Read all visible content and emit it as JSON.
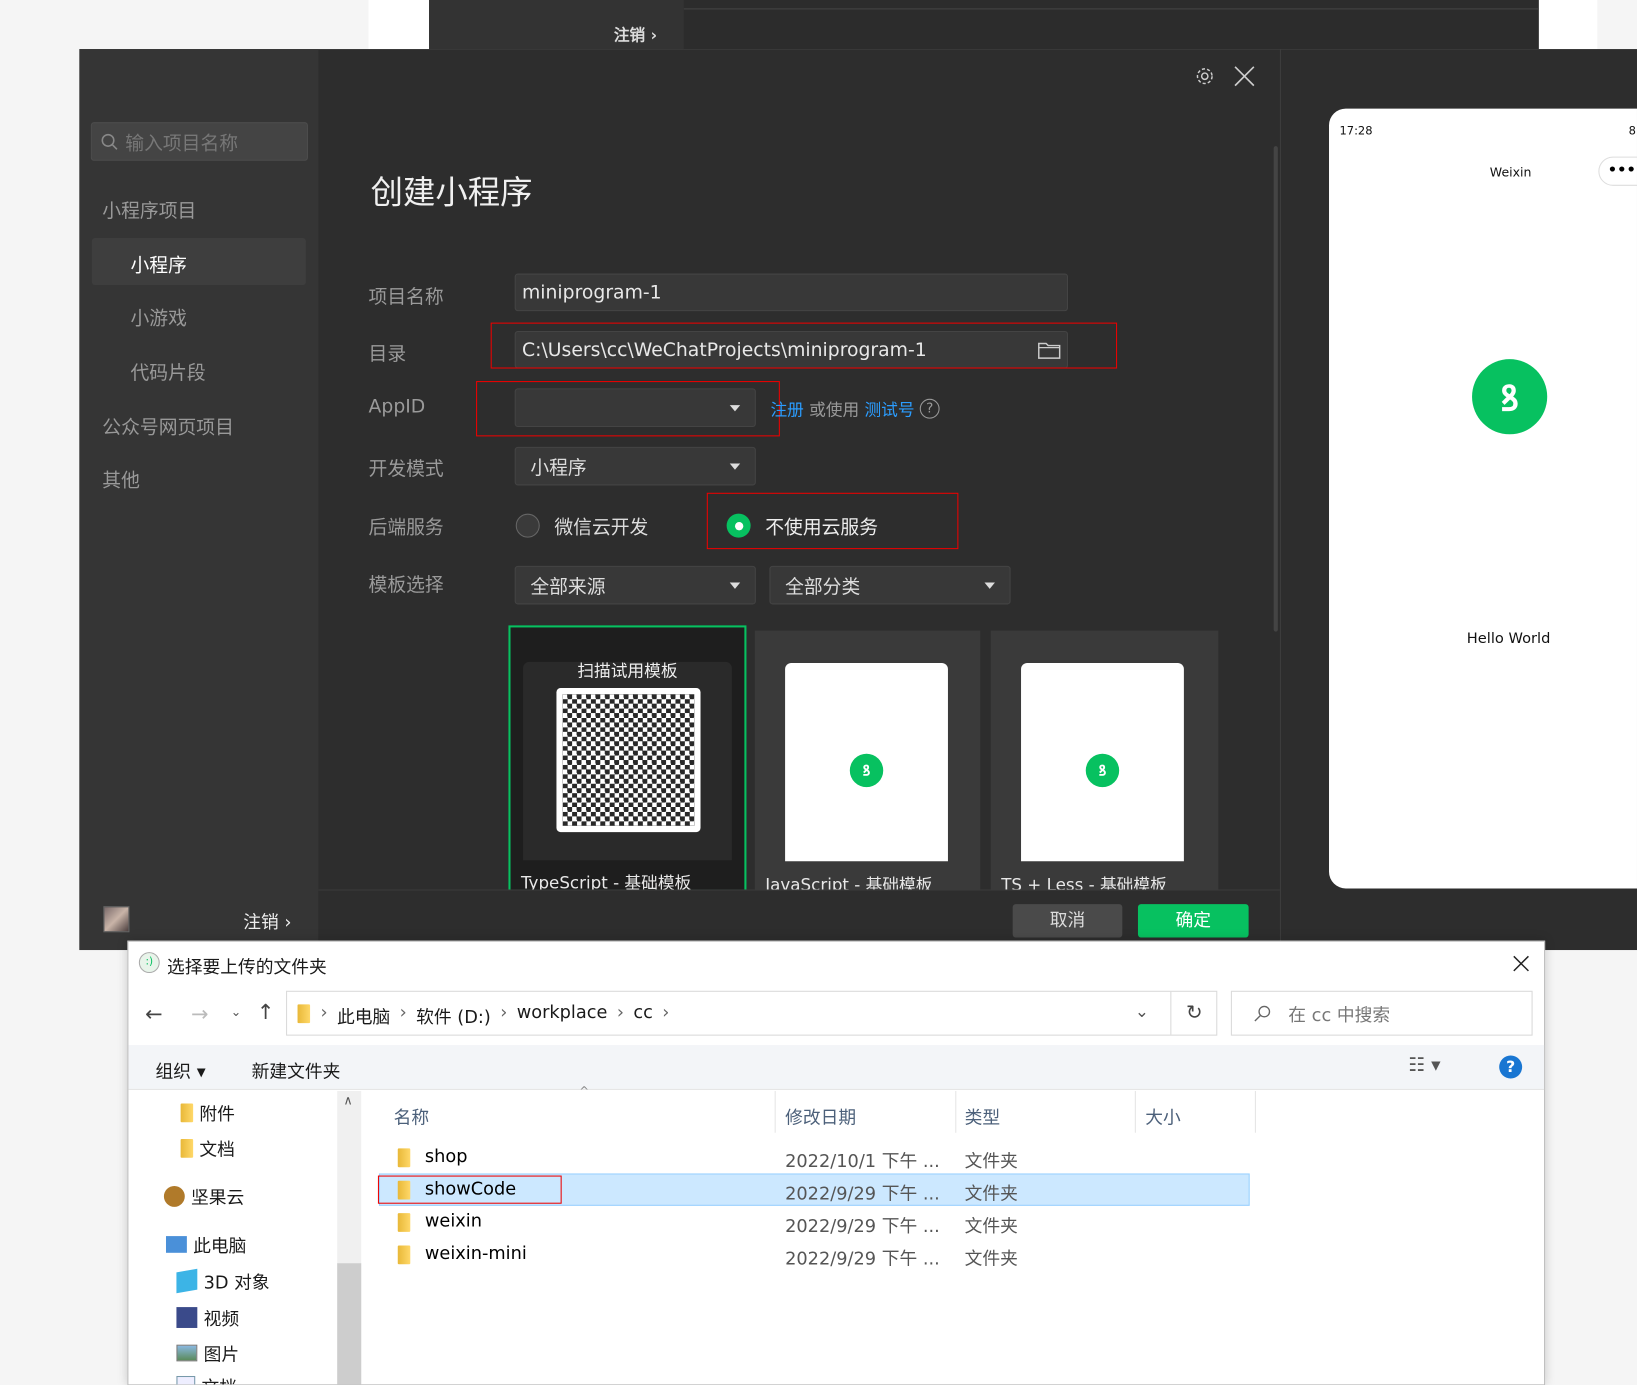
{
  "bg_window": {
    "logout": "注销 ›"
  },
  "sidebar": {
    "search_placeholder": "输入项目名称",
    "items": [
      {
        "label": "小程序项目"
      },
      {
        "label": "小程序"
      },
      {
        "label": "小游戏"
      },
      {
        "label": "代码片段"
      },
      {
        "label": "公众号网页项目"
      },
      {
        "label": "其他"
      }
    ],
    "logout": "注销 ›"
  },
  "dialog": {
    "title": "创建小程序",
    "fields": {
      "name_label": "项目名称",
      "name_value": "miniprogram-1",
      "dir_label": "目录",
      "dir_value": "C:\\Users\\cc\\WeChatProjects\\miniprogram-1",
      "appid_label": "AppID",
      "appid_register": "注册",
      "appid_or": "或使用",
      "appid_test": "测试号",
      "mode_label": "开发模式",
      "mode_value": "小程序",
      "backend_label": "后端服务",
      "backend_opt1": "微信云开发",
      "backend_opt2": "不使用云服务",
      "template_label": "模板选择",
      "source_value": "全部来源",
      "category_value": "全部分类"
    },
    "templates": [
      {
        "label": "TypeScript - 基础模板",
        "scan": "扫描试用模板"
      },
      {
        "label": "JavaScript - 基础模板"
      },
      {
        "label": "TS + Less - 基础模板"
      }
    ],
    "cancel": "取消",
    "confirm": "确定"
  },
  "preview": {
    "time": "17:28",
    "battery": "8",
    "title": "Weixin",
    "hello": "Hello World"
  },
  "colors": {
    "accent": "#07c160",
    "link": "#2b9dff",
    "highlight": "#e00000"
  },
  "file_dialog": {
    "title": "选择要上传的文件夹",
    "breadcrumb": [
      "此电脑",
      "软件 (D:)",
      "workplace",
      "cc"
    ],
    "search_placeholder": "在 cc 中搜索",
    "toolbar": {
      "organize": "组织 ▾",
      "new_folder": "新建文件夹"
    },
    "nav": [
      {
        "label": "附件"
      },
      {
        "label": "文档"
      },
      {
        "label": "坚果云"
      },
      {
        "label": "此电脑"
      },
      {
        "label": "3D 对象"
      },
      {
        "label": "视频"
      },
      {
        "label": "图片"
      },
      {
        "label": "文档"
      }
    ],
    "columns": [
      "名称",
      "修改日期",
      "类型",
      "大小"
    ],
    "rows": [
      {
        "name": "shop",
        "date": "2022/10/1 下午 ...",
        "type": "文件夹"
      },
      {
        "name": "showCode",
        "date": "2022/9/29 下午 ...",
        "type": "文件夹"
      },
      {
        "name": "weixin",
        "date": "2022/9/29 下午 ...",
        "type": "文件夹"
      },
      {
        "name": "weixin-mini",
        "date": "2022/9/29 下午 ...",
        "type": "文件夹"
      }
    ]
  }
}
